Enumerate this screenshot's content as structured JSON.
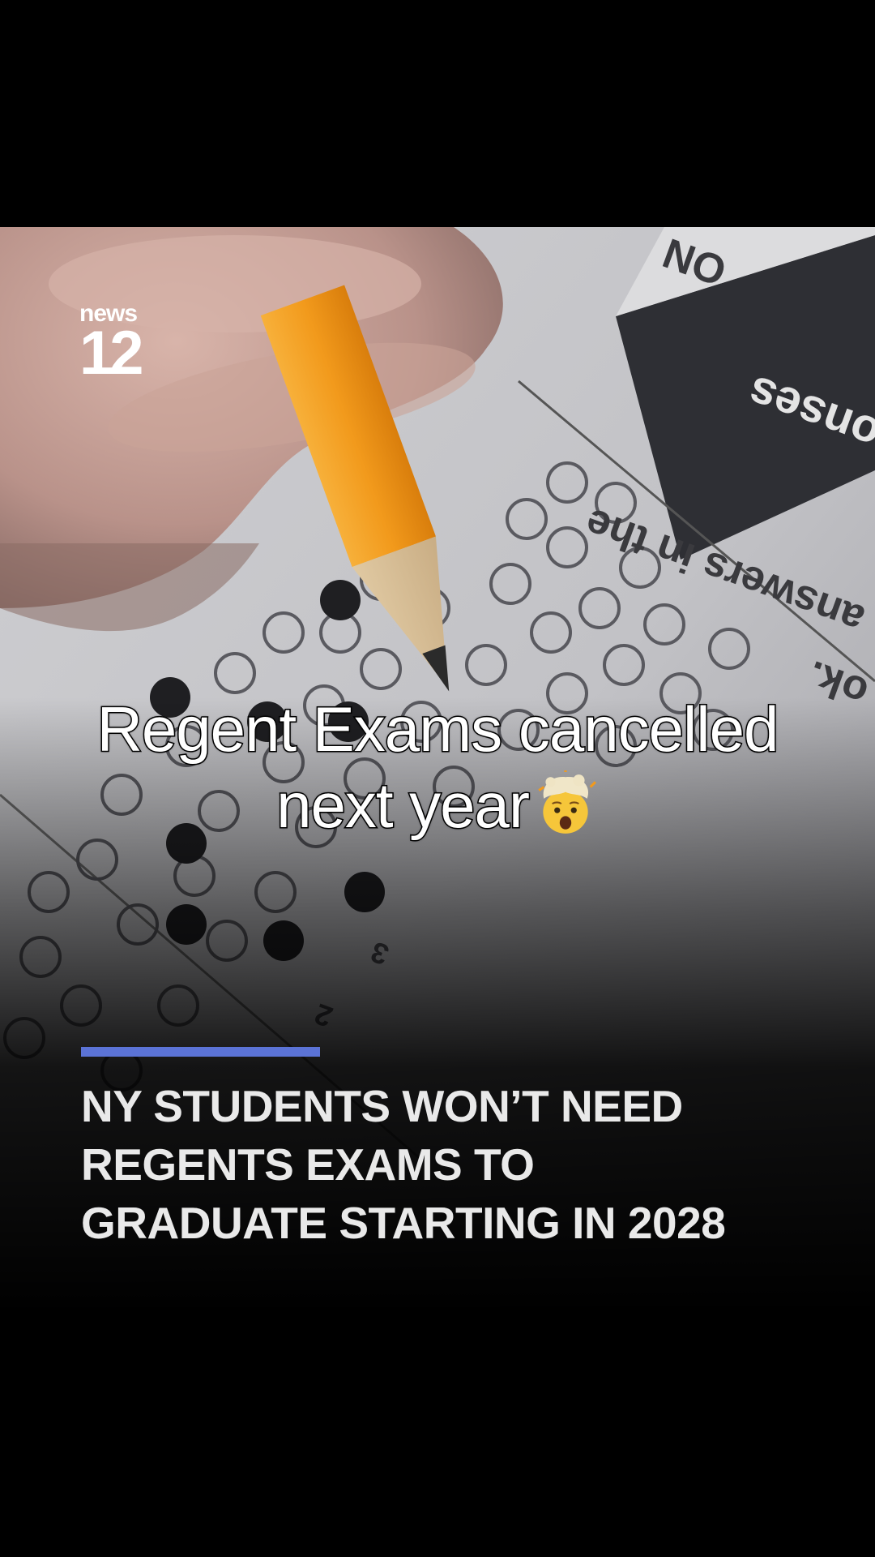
{
  "video": {
    "logo": {
      "word": "news",
      "number": "12"
    },
    "caption": {
      "line1": "Regent Exams cancelled",
      "line2": "next year",
      "emoji": "exploding-head-icon"
    },
    "lower_third": {
      "accent_color": "#5b73d6",
      "headline_lines": [
        "NY STUDENTS WON’T NEED",
        "REGENTS EXAMS TO",
        "GRADUATE STARTING IN 2028"
      ]
    },
    "background_text": {
      "upside_down_line1": "answers in the",
      "upside_down_line2": "ok.",
      "banner_fragment": "onses",
      "corner_fragment": "ON"
    }
  },
  "colors": {
    "background": "#000000",
    "pencil": "#f29a1c",
    "caption_text": "#ffffff"
  }
}
